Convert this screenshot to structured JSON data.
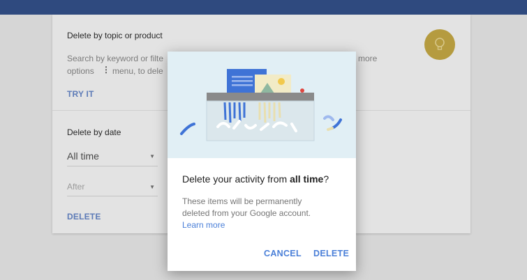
{
  "card": {
    "topic_section": {
      "title": "Delete by topic or product",
      "description_line1_left": "Search by keyword or filte",
      "description_line1_right": "more",
      "description_line2_left": "options",
      "description_line2_right": "menu, to dele",
      "try_label": "TRY IT"
    },
    "date_section": {
      "title": "Delete by date",
      "range_value": "All time",
      "after_placeholder": "After",
      "delete_label": "DELETE"
    }
  },
  "dialog": {
    "title_prefix": "Delete your activity from ",
    "title_bold": "all time",
    "title_suffix": "?",
    "body_line1": "These items will be permanently",
    "body_line2": "deleted from your Google account.",
    "learn_more": "Learn more",
    "cancel_label": "CANCEL",
    "delete_label": "DELETE"
  },
  "colors": {
    "topbar": "#2f4a7f",
    "accent": "#4a7fd8",
    "bulb": "#b59b3f",
    "illustration_bg": "#e1eff5"
  },
  "icons": {
    "menu": "more-vert-icon",
    "dropdown": "dropdown-arrow-icon",
    "bulb": "lightbulb-icon",
    "shredder": "shredder-illustration"
  }
}
